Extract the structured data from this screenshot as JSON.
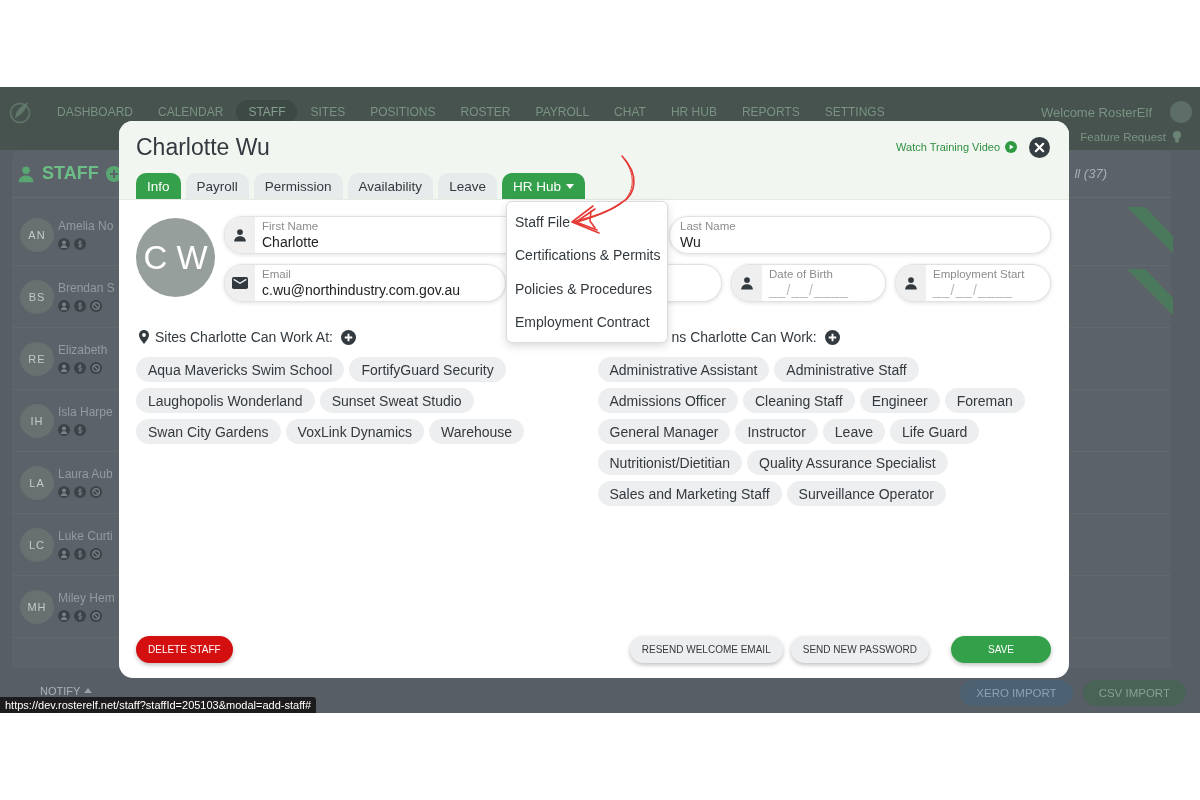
{
  "background_app": {
    "nav": {
      "items": [
        {
          "label": "DASHBOARD",
          "selected": false
        },
        {
          "label": "CALENDAR",
          "selected": false
        },
        {
          "label": "STAFF",
          "selected": true
        },
        {
          "label": "SITES",
          "selected": false
        },
        {
          "label": "POSITIONS",
          "selected": false
        },
        {
          "label": "ROSTER",
          "selected": false
        },
        {
          "label": "PAYROLL",
          "selected": false
        },
        {
          "label": "CHAT",
          "selected": false
        },
        {
          "label": "HR HUB",
          "selected": false
        },
        {
          "label": "REPORTS",
          "selected": false
        },
        {
          "label": "SETTINGS",
          "selected": false
        }
      ],
      "welcome": "Welcome RosterElf",
      "feature_request": "Feature Request"
    },
    "staff_panel": {
      "title": "STAFF",
      "count": "ll (37)",
      "rows": [
        {
          "initials": "AN",
          "name": "Amelia No",
          "blocked": false,
          "ribbon": true
        },
        {
          "initials": "BS",
          "name": "Brendan S",
          "blocked": true,
          "ribbon": true
        },
        {
          "initials": "RE",
          "name": "Elizabeth",
          "blocked": true,
          "ribbon": false
        },
        {
          "initials": "IH",
          "name": "Isla Harpe",
          "blocked": false,
          "ribbon": false
        },
        {
          "initials": "LA",
          "name": "Laura Aub",
          "blocked": true,
          "ribbon": false
        },
        {
          "initials": "LC",
          "name": "Luke Curti",
          "blocked": true,
          "ribbon": false
        },
        {
          "initials": "MH",
          "name": "Miley Hem",
          "blocked": true,
          "ribbon": false
        }
      ],
      "notify": "NOTIFY"
    },
    "buttons": [
      {
        "label": "XERO IMPORT",
        "kind": "xero"
      },
      {
        "label": "CSV IMPORT",
        "kind": "csv"
      }
    ]
  },
  "modal": {
    "title": "Charlotte Wu",
    "training_link": "Watch Training Video",
    "tabs": [
      {
        "label": "Info",
        "kind": "tab",
        "selected": true
      },
      {
        "label": "Payroll",
        "kind": "tab",
        "selected": false
      },
      {
        "label": "Permission",
        "kind": "tab",
        "selected": false
      },
      {
        "label": "Availability",
        "kind": "tab",
        "selected": false
      },
      {
        "label": "Leave",
        "kind": "tab",
        "selected": false
      },
      {
        "label": "HR Hub",
        "kind": "menu",
        "expanded": true,
        "items": [
          "Staff File",
          "Certifications & Permits",
          "Policies & Procedures",
          "Employment Contract"
        ]
      }
    ],
    "avatar_initials": "C W",
    "field_rows": [
      {
        "fields": [
          {
            "kind": "name",
            "label": "First Name",
            "value": "Charlotte"
          },
          {
            "kind": "plain",
            "label": "Last Name",
            "value": "Wu"
          }
        ]
      },
      {
        "fields": [
          {
            "kind": "email",
            "label": "Email",
            "value": "c.wu@northindustry.com.gov.au"
          },
          {
            "kind": "plain"
          },
          {
            "kind": "date",
            "label": "Date of Birth",
            "placeholder": "__/__/____"
          },
          {
            "kind": "date",
            "label": "Employment Start",
            "placeholder": "__/__/____"
          }
        ]
      }
    ],
    "sites": {
      "heading": "Sites Charlotte Can Work At:",
      "items": [
        "Aqua Mavericks Swim School",
        "FortifyGuard Security",
        "Laughopolis Wonderland",
        "Sunset Sweat Studio",
        "Swan City Gardens",
        "VoxLink Dynamics",
        "Warehouse"
      ]
    },
    "positions": {
      "heading": "ns Charlotte Can Work:",
      "items": [
        "Administrative Assistant",
        "Administrative Staff",
        "Admissions Officer",
        "Cleaning Staff",
        "Engineer",
        "Foreman",
        "General Manager",
        "Instructor",
        "Leave",
        "Life Guard",
        "Nutritionist/Dietitian",
        "Quality Assurance Specialist",
        "Sales and Marketing Staff",
        "Surveillance Operator"
      ]
    },
    "buttons": [
      {
        "label": "DELETE STAFF",
        "kind": "danger"
      },
      {
        "label": "RESEND WELCOME EMAIL",
        "kind": "secondary"
      },
      {
        "label": "SEND NEW PASSWORD",
        "kind": "secondary"
      },
      {
        "label": "SAVE",
        "kind": "primary"
      }
    ]
  },
  "status_url": "https://dev.rosterelf.net/staff?staffId=205103&modal=add-staff#"
}
